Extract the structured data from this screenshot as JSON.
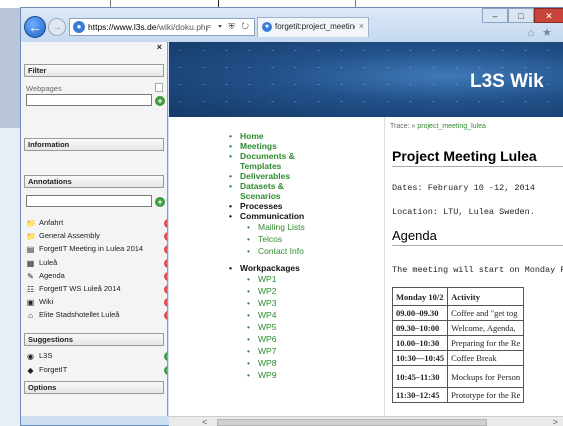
{
  "browser": {
    "url_prefix": "https://www.l3s.de",
    "url_rest": "/wiki/doku.php?id=forgetit:projec",
    "tab_label": "forgetit:project_meeting_lul...",
    "tab_close": "×",
    "back_glyph": "←",
    "fwd_glyph": "→",
    "addr_tools": "⌕ ▾ ⛨ ↻",
    "win_min": "–",
    "win_max": "□",
    "win_close": "✕",
    "home_glyph": "⌂",
    "star_glyph": "★"
  },
  "sidebar": {
    "close_label": "×",
    "filter_title": "Filter",
    "webpages_label": "Webpages",
    "information_title": "Information",
    "annotations_title": "Annotations",
    "arrow_glyph": "⇒",
    "annotations": [
      {
        "label": "Anfahrt",
        "icon": "📁"
      },
      {
        "label": "General Assembly",
        "icon": "📁"
      },
      {
        "label": "ForgetIT Meeting in Lulea 2014",
        "icon": "▤"
      },
      {
        "label": "Luleå",
        "icon": "▦"
      },
      {
        "label": "Agenda",
        "icon": "✎"
      },
      {
        "label": "ForgetIT WS Luleå 2014",
        "icon": "☷"
      },
      {
        "label": "Wiki",
        "icon": "▣"
      },
      {
        "label": "Elite Stadshotellet Luleå",
        "icon": "⌂"
      }
    ],
    "suggestions_title": "Suggestions",
    "suggestions": [
      {
        "label": "L3S",
        "icon": "◉"
      },
      {
        "label": "ForgetIT",
        "icon": "◆"
      }
    ],
    "options_title": "Options"
  },
  "content": {
    "site_title": "L3S Wik",
    "trace_prefix": "Trace: » ",
    "trace_link": "project_meeting_lulea",
    "nav": {
      "home": "Home",
      "meetings": "Meetings",
      "documents": "Documents &",
      "documents2": "Templates",
      "deliverables": "Deliverables",
      "datasets": "Datasets &",
      "datasets2": "Scenarios",
      "processes": "Processes",
      "communication": "Communication",
      "mailing": "Mailing Lists",
      "telcos": "Telcos",
      "contact": "Contact Info",
      "workpackages": "Workpackages",
      "wps": [
        "WP1",
        "WP2",
        "WP3",
        "WP4",
        "WP5",
        "WP6",
        "WP7",
        "WP8",
        "WP9"
      ]
    },
    "heading": "Project Meeting Lulea",
    "dates": "Dates: February 10 -12, 2014",
    "location": "Location: LTU, Lulea Sweden.",
    "agenda_heading": "Agenda",
    "agenda_intro": "The meeting will start on Monday F",
    "table": {
      "headers": [
        "Monday 10/2",
        "Activity"
      ],
      "rows": [
        [
          "09.00–09.30",
          "Coffee and \"get tog"
        ],
        [
          "09.30–10:00",
          "Welcome, Agenda,"
        ],
        [
          "10.00–10:30",
          "Preparing for the Re"
        ],
        [
          "10:30—10:45",
          "Coffee Break"
        ],
        [
          "10:45–11:30",
          "Mockups for Person"
        ],
        [
          "11:30–12:45",
          "Prototype for the Re"
        ]
      ]
    }
  },
  "scroll": {
    "left": "<",
    "right": ">"
  }
}
